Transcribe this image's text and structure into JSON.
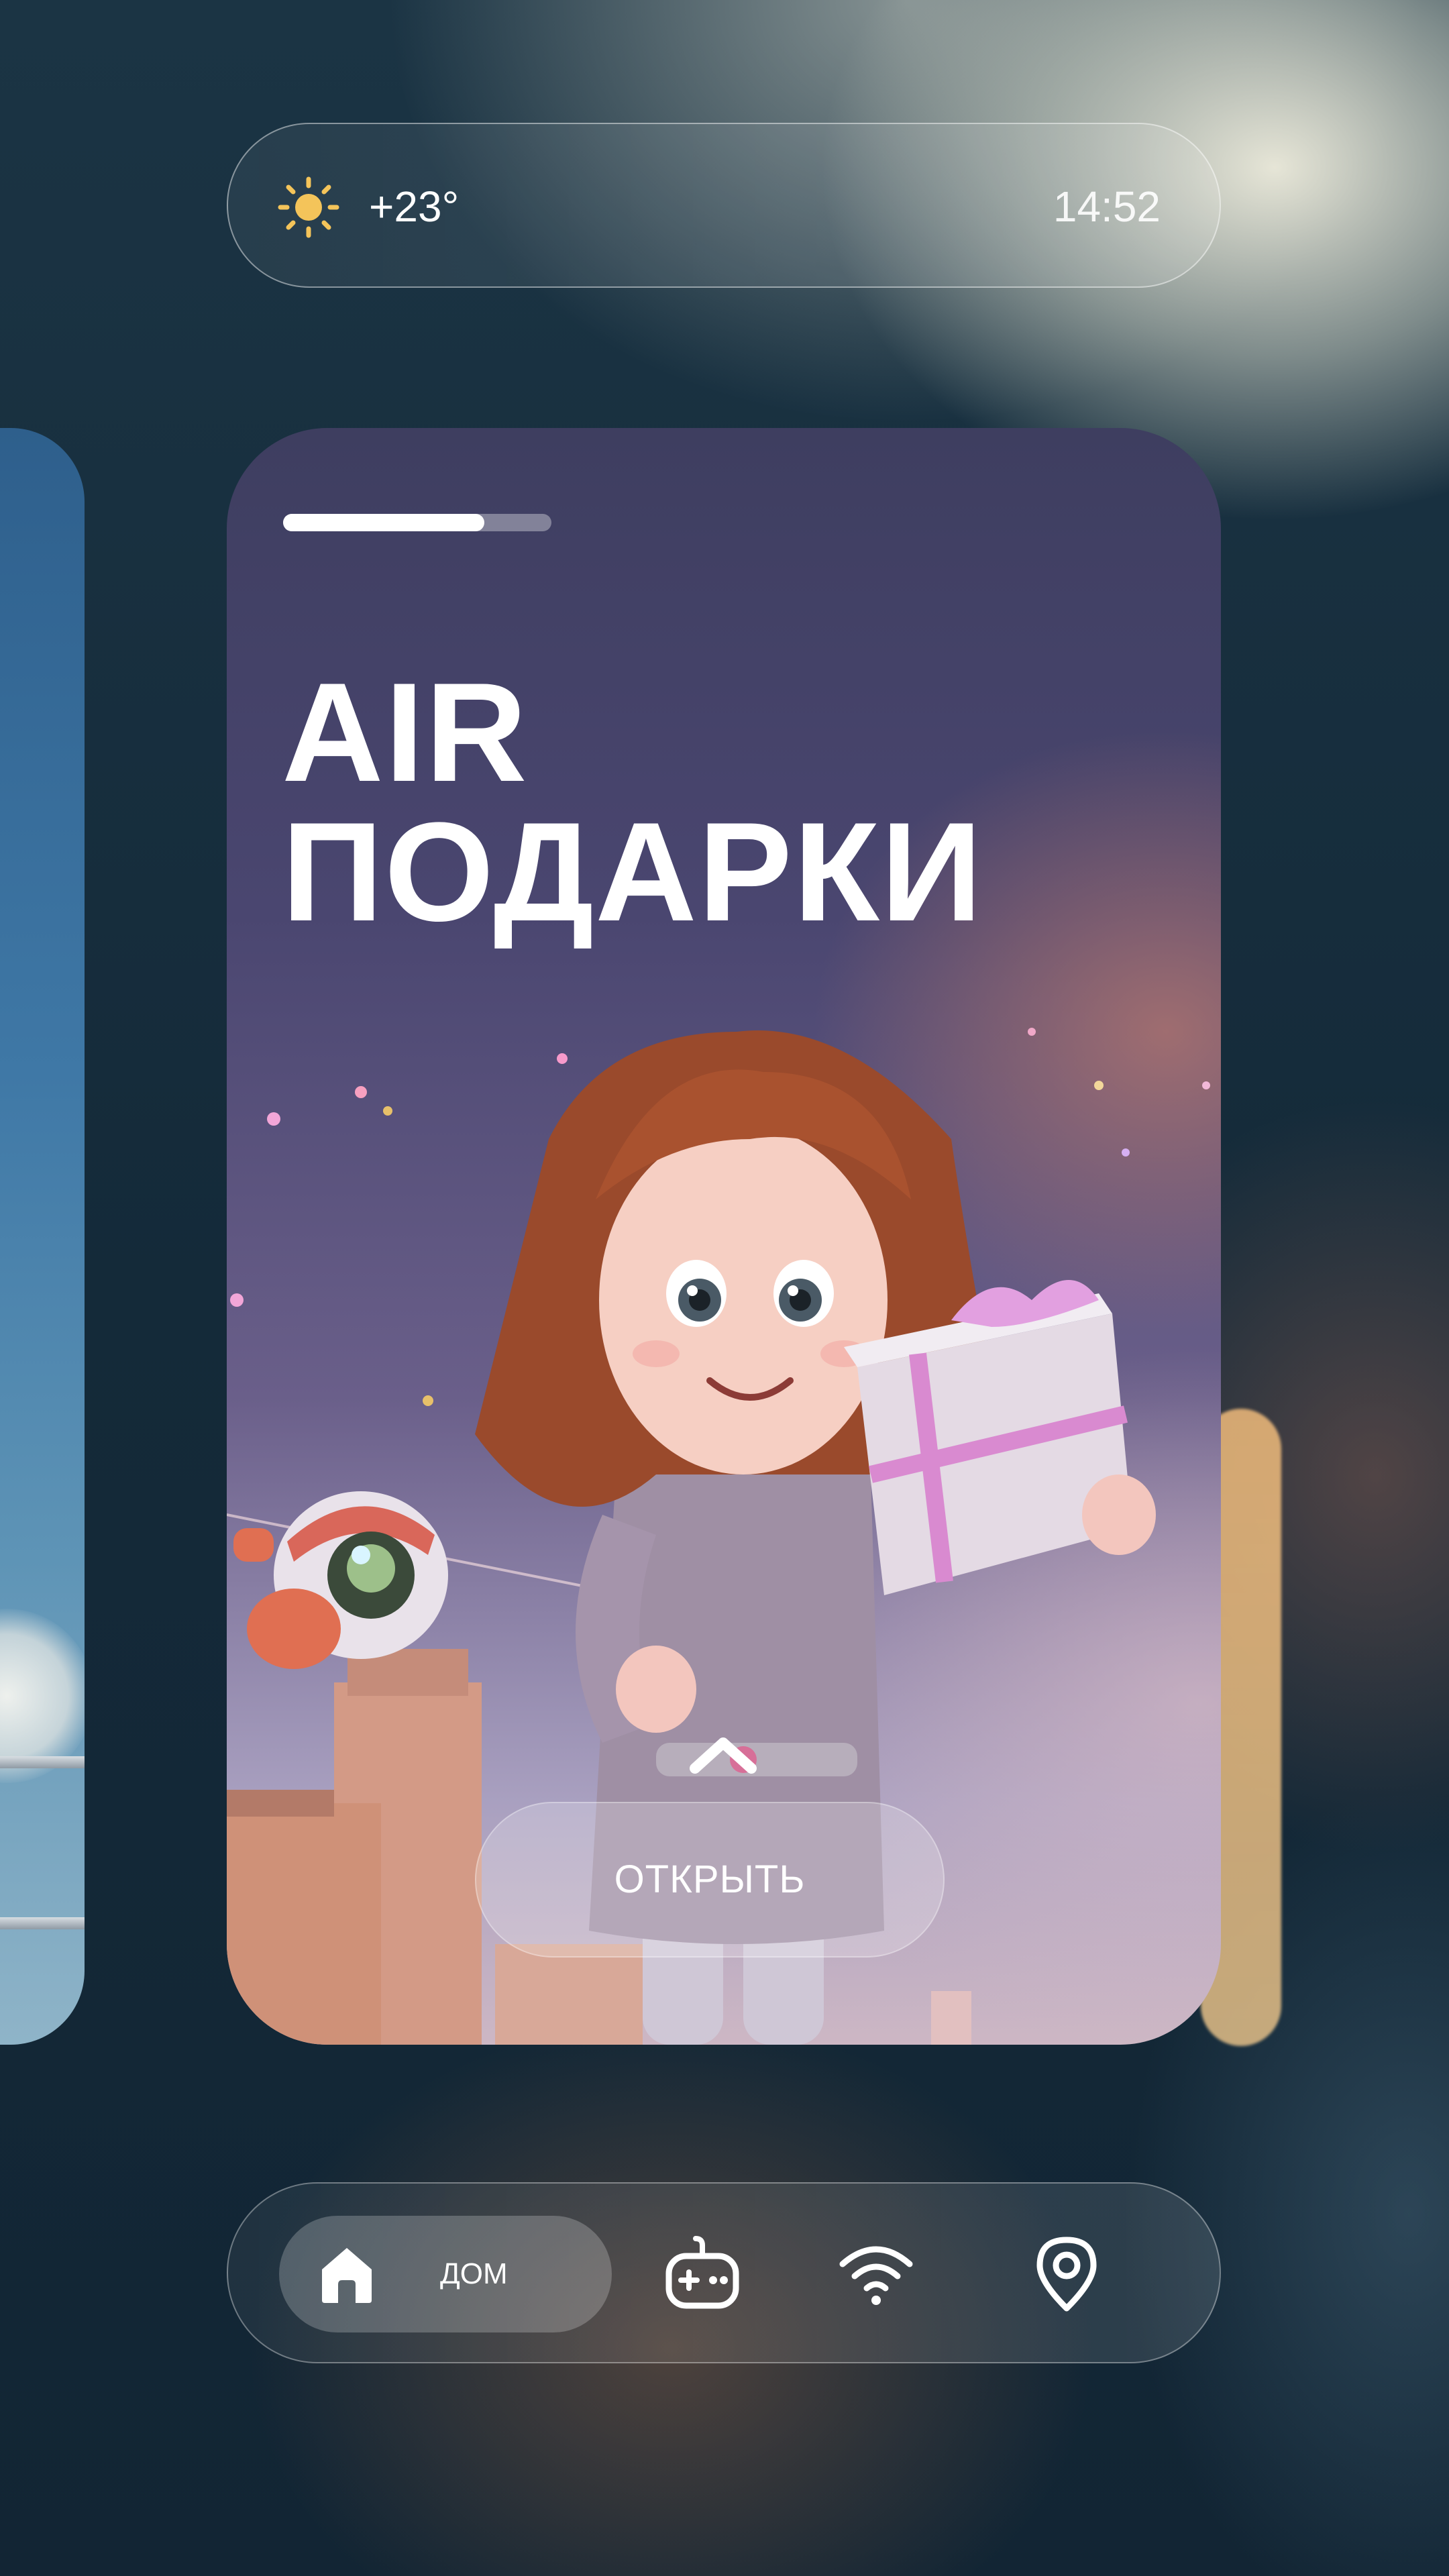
{
  "status": {
    "weather_icon": "sun-icon",
    "temperature": "+23°",
    "time": "14:52"
  },
  "card": {
    "progress": 0.75,
    "title_line1": "AIR",
    "title_line2": "ПОДАРКИ",
    "open_button_label": "ОТКРЫТЬ"
  },
  "nav": {
    "items": [
      {
        "icon": "home-icon",
        "label": "ДОМ",
        "active": true
      },
      {
        "icon": "gamepad-icon",
        "label": "",
        "active": false
      },
      {
        "icon": "wifi-icon",
        "label": "",
        "active": false
      },
      {
        "icon": "location-pin-icon",
        "label": "",
        "active": false
      }
    ]
  },
  "colors": {
    "accent_sun": "#F4C45A",
    "text": "#FFFFFF"
  }
}
